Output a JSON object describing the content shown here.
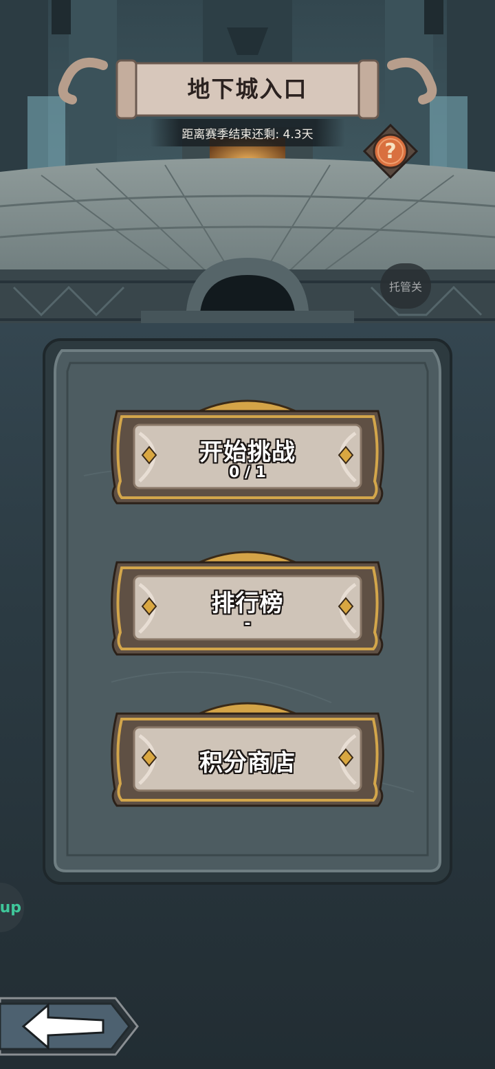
{
  "header": {
    "title": "地下城入口",
    "season_remaining": "距离赛季结束还剩: 4.3天"
  },
  "help": {
    "glyph": "?",
    "icon": "question-mark-icon"
  },
  "auto_toggle": {
    "label": "托管关"
  },
  "menu": {
    "buttons": [
      {
        "label": "开始挑战",
        "sub": "0 / 1"
      },
      {
        "label": "排行榜",
        "sub": "-"
      },
      {
        "label": "积分商店",
        "sub": ""
      }
    ]
  },
  "side_tab": {
    "label": "up"
  },
  "back": {
    "icon": "back-arrow-icon"
  },
  "colors": {
    "gold": "#c9983f",
    "parchment": "#cfc4b8",
    "panel": "#4d5c61",
    "help_orange": "#d9703f"
  }
}
